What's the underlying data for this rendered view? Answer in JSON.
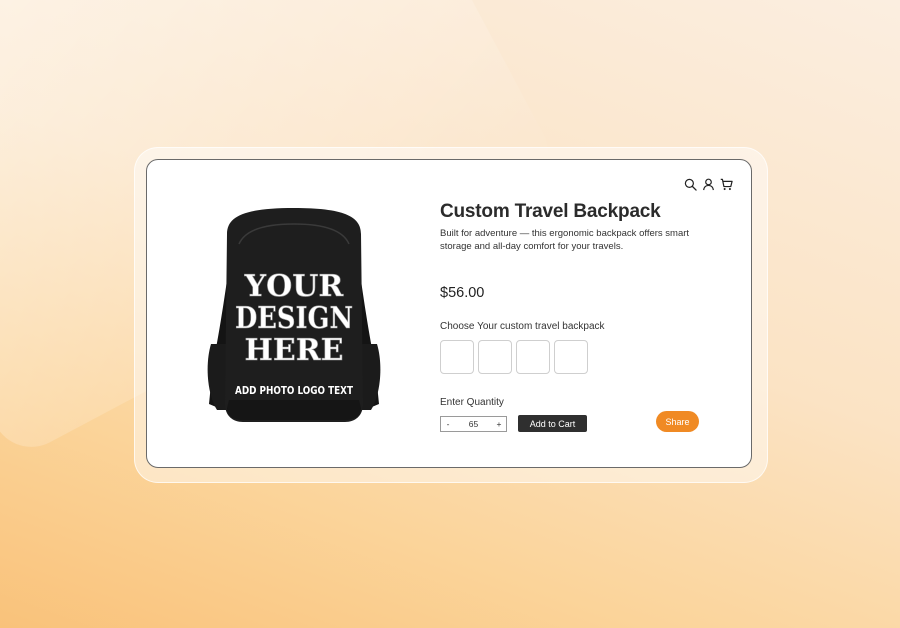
{
  "product": {
    "title": "Custom Travel Backpack",
    "description": "Built for adventure — this ergonomic backpack offers smart storage and all-day comfort for your travels.",
    "price": "$56.00",
    "image_text": {
      "line1": "YOUR",
      "line2": "DESIGN",
      "line3": "HERE",
      "line4": "ADD PHOTO LOGO TEXT"
    }
  },
  "header": {
    "icons": [
      "search-icon",
      "user-icon",
      "cart-icon"
    ]
  },
  "options": {
    "label": "Choose Your custom travel backpack",
    "swatch_count": 4
  },
  "quantity": {
    "label": "Enter Quantity",
    "minus": "-",
    "value": "65",
    "plus": "+"
  },
  "actions": {
    "add_to_cart": "Add to Cart",
    "share": "Share"
  },
  "colors": {
    "accent": "#f08a24",
    "button_dark": "#2f2f2f"
  }
}
